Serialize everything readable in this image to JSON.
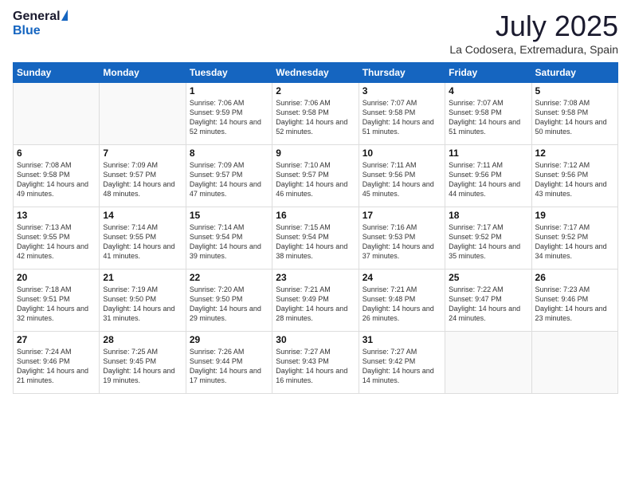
{
  "header": {
    "logo_general": "General",
    "logo_blue": "Blue",
    "month_title": "July 2025",
    "location": "La Codosera, Extremadura, Spain"
  },
  "weekdays": [
    "Sunday",
    "Monday",
    "Tuesday",
    "Wednesday",
    "Thursday",
    "Friday",
    "Saturday"
  ],
  "weeks": [
    [
      {
        "day": "",
        "sunrise": "",
        "sunset": "",
        "daylight": ""
      },
      {
        "day": "",
        "sunrise": "",
        "sunset": "",
        "daylight": ""
      },
      {
        "day": "1",
        "sunrise": "Sunrise: 7:06 AM",
        "sunset": "Sunset: 9:59 PM",
        "daylight": "Daylight: 14 hours and 52 minutes."
      },
      {
        "day": "2",
        "sunrise": "Sunrise: 7:06 AM",
        "sunset": "Sunset: 9:58 PM",
        "daylight": "Daylight: 14 hours and 52 minutes."
      },
      {
        "day": "3",
        "sunrise": "Sunrise: 7:07 AM",
        "sunset": "Sunset: 9:58 PM",
        "daylight": "Daylight: 14 hours and 51 minutes."
      },
      {
        "day": "4",
        "sunrise": "Sunrise: 7:07 AM",
        "sunset": "Sunset: 9:58 PM",
        "daylight": "Daylight: 14 hours and 51 minutes."
      },
      {
        "day": "5",
        "sunrise": "Sunrise: 7:08 AM",
        "sunset": "Sunset: 9:58 PM",
        "daylight": "Daylight: 14 hours and 50 minutes."
      }
    ],
    [
      {
        "day": "6",
        "sunrise": "Sunrise: 7:08 AM",
        "sunset": "Sunset: 9:58 PM",
        "daylight": "Daylight: 14 hours and 49 minutes."
      },
      {
        "day": "7",
        "sunrise": "Sunrise: 7:09 AM",
        "sunset": "Sunset: 9:57 PM",
        "daylight": "Daylight: 14 hours and 48 minutes."
      },
      {
        "day": "8",
        "sunrise": "Sunrise: 7:09 AM",
        "sunset": "Sunset: 9:57 PM",
        "daylight": "Daylight: 14 hours and 47 minutes."
      },
      {
        "day": "9",
        "sunrise": "Sunrise: 7:10 AM",
        "sunset": "Sunset: 9:57 PM",
        "daylight": "Daylight: 14 hours and 46 minutes."
      },
      {
        "day": "10",
        "sunrise": "Sunrise: 7:11 AM",
        "sunset": "Sunset: 9:56 PM",
        "daylight": "Daylight: 14 hours and 45 minutes."
      },
      {
        "day": "11",
        "sunrise": "Sunrise: 7:11 AM",
        "sunset": "Sunset: 9:56 PM",
        "daylight": "Daylight: 14 hours and 44 minutes."
      },
      {
        "day": "12",
        "sunrise": "Sunrise: 7:12 AM",
        "sunset": "Sunset: 9:56 PM",
        "daylight": "Daylight: 14 hours and 43 minutes."
      }
    ],
    [
      {
        "day": "13",
        "sunrise": "Sunrise: 7:13 AM",
        "sunset": "Sunset: 9:55 PM",
        "daylight": "Daylight: 14 hours and 42 minutes."
      },
      {
        "day": "14",
        "sunrise": "Sunrise: 7:14 AM",
        "sunset": "Sunset: 9:55 PM",
        "daylight": "Daylight: 14 hours and 41 minutes."
      },
      {
        "day": "15",
        "sunrise": "Sunrise: 7:14 AM",
        "sunset": "Sunset: 9:54 PM",
        "daylight": "Daylight: 14 hours and 39 minutes."
      },
      {
        "day": "16",
        "sunrise": "Sunrise: 7:15 AM",
        "sunset": "Sunset: 9:54 PM",
        "daylight": "Daylight: 14 hours and 38 minutes."
      },
      {
        "day": "17",
        "sunrise": "Sunrise: 7:16 AM",
        "sunset": "Sunset: 9:53 PM",
        "daylight": "Daylight: 14 hours and 37 minutes."
      },
      {
        "day": "18",
        "sunrise": "Sunrise: 7:17 AM",
        "sunset": "Sunset: 9:52 PM",
        "daylight": "Daylight: 14 hours and 35 minutes."
      },
      {
        "day": "19",
        "sunrise": "Sunrise: 7:17 AM",
        "sunset": "Sunset: 9:52 PM",
        "daylight": "Daylight: 14 hours and 34 minutes."
      }
    ],
    [
      {
        "day": "20",
        "sunrise": "Sunrise: 7:18 AM",
        "sunset": "Sunset: 9:51 PM",
        "daylight": "Daylight: 14 hours and 32 minutes."
      },
      {
        "day": "21",
        "sunrise": "Sunrise: 7:19 AM",
        "sunset": "Sunset: 9:50 PM",
        "daylight": "Daylight: 14 hours and 31 minutes."
      },
      {
        "day": "22",
        "sunrise": "Sunrise: 7:20 AM",
        "sunset": "Sunset: 9:50 PM",
        "daylight": "Daylight: 14 hours and 29 minutes."
      },
      {
        "day": "23",
        "sunrise": "Sunrise: 7:21 AM",
        "sunset": "Sunset: 9:49 PM",
        "daylight": "Daylight: 14 hours and 28 minutes."
      },
      {
        "day": "24",
        "sunrise": "Sunrise: 7:21 AM",
        "sunset": "Sunset: 9:48 PM",
        "daylight": "Daylight: 14 hours and 26 minutes."
      },
      {
        "day": "25",
        "sunrise": "Sunrise: 7:22 AM",
        "sunset": "Sunset: 9:47 PM",
        "daylight": "Daylight: 14 hours and 24 minutes."
      },
      {
        "day": "26",
        "sunrise": "Sunrise: 7:23 AM",
        "sunset": "Sunset: 9:46 PM",
        "daylight": "Daylight: 14 hours and 23 minutes."
      }
    ],
    [
      {
        "day": "27",
        "sunrise": "Sunrise: 7:24 AM",
        "sunset": "Sunset: 9:46 PM",
        "daylight": "Daylight: 14 hours and 21 minutes."
      },
      {
        "day": "28",
        "sunrise": "Sunrise: 7:25 AM",
        "sunset": "Sunset: 9:45 PM",
        "daylight": "Daylight: 14 hours and 19 minutes."
      },
      {
        "day": "29",
        "sunrise": "Sunrise: 7:26 AM",
        "sunset": "Sunset: 9:44 PM",
        "daylight": "Daylight: 14 hours and 17 minutes."
      },
      {
        "day": "30",
        "sunrise": "Sunrise: 7:27 AM",
        "sunset": "Sunset: 9:43 PM",
        "daylight": "Daylight: 14 hours and 16 minutes."
      },
      {
        "day": "31",
        "sunrise": "Sunrise: 7:27 AM",
        "sunset": "Sunset: 9:42 PM",
        "daylight": "Daylight: 14 hours and 14 minutes."
      },
      {
        "day": "",
        "sunrise": "",
        "sunset": "",
        "daylight": ""
      },
      {
        "day": "",
        "sunrise": "",
        "sunset": "",
        "daylight": ""
      }
    ]
  ]
}
